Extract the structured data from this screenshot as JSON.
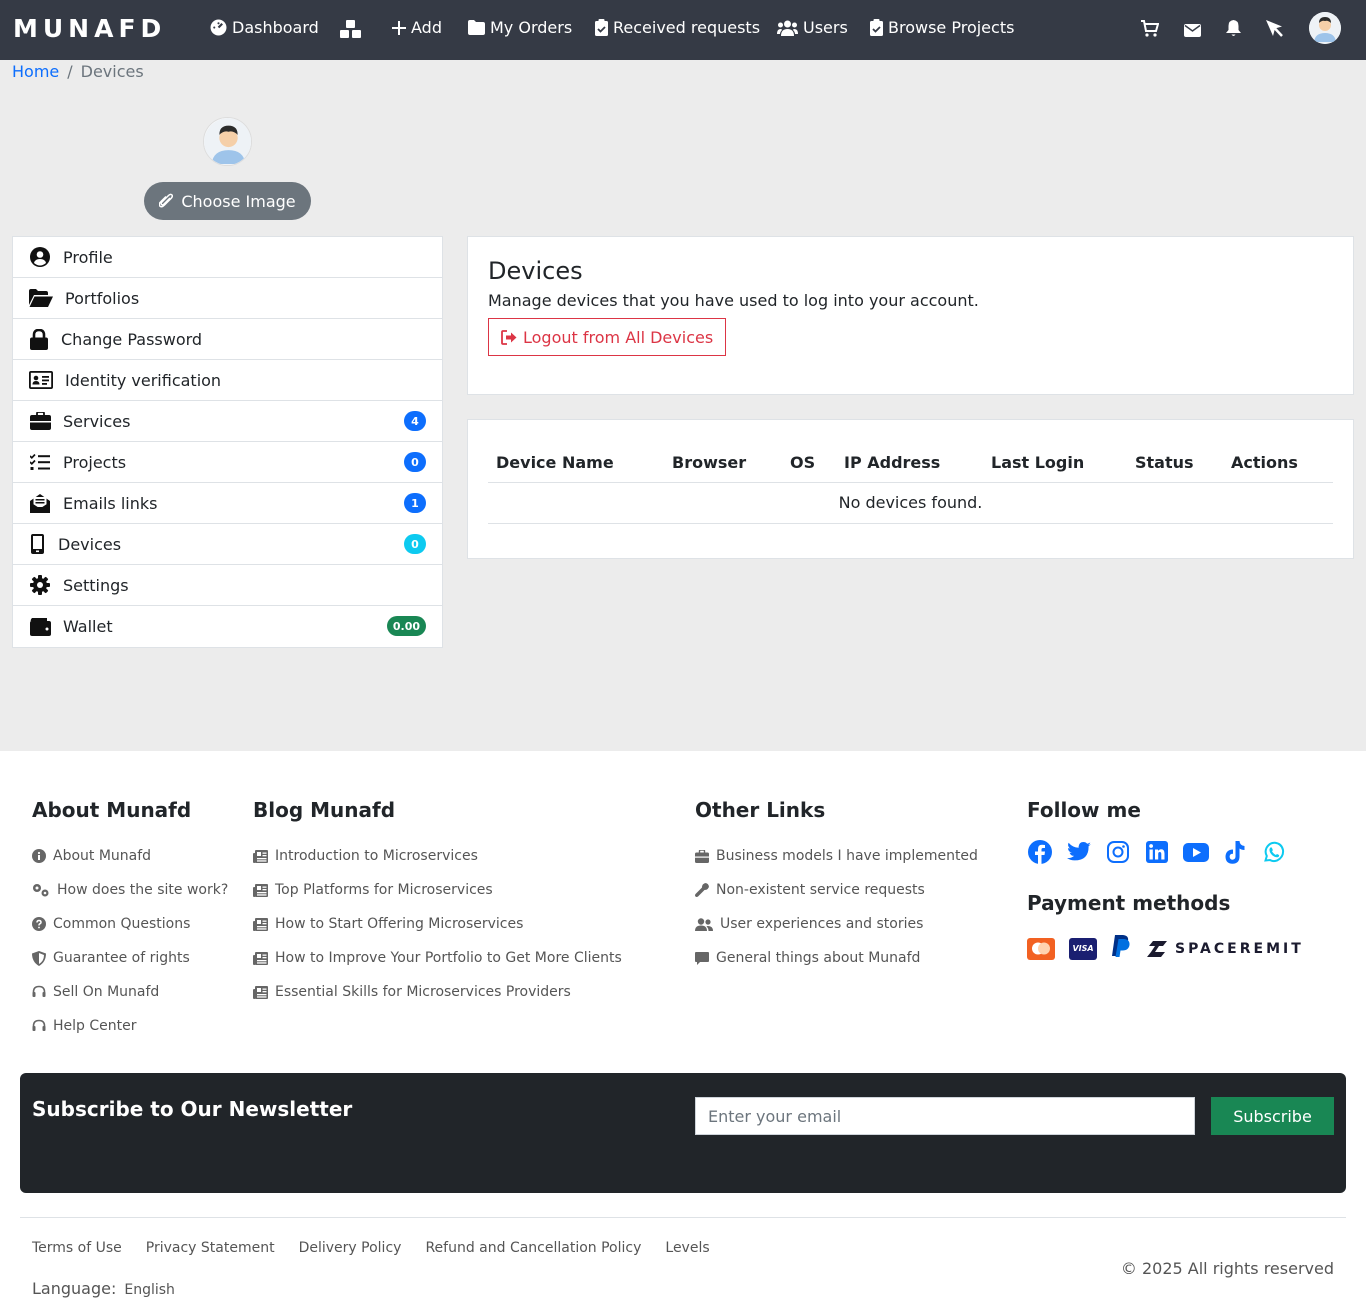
{
  "navbar": {
    "brand": "MUNAFD",
    "items": [
      {
        "label": "Dashboard"
      },
      {
        "label": "Add"
      },
      {
        "label": "My Orders"
      },
      {
        "label": "Received requests"
      },
      {
        "label": "Users"
      },
      {
        "label": "Browse Projects"
      }
    ]
  },
  "breadcrumb": {
    "home": "Home",
    "sep": "/",
    "current": "Devices"
  },
  "profile": {
    "choose_image": "Choose Image"
  },
  "sidebar": {
    "items": [
      {
        "label": "Profile",
        "icon": "user-circle-icon"
      },
      {
        "label": "Portfolios",
        "icon": "folder-open-icon"
      },
      {
        "label": "Change Password",
        "icon": "lock-icon"
      },
      {
        "label": "Identity verification",
        "icon": "id-card-icon"
      },
      {
        "label": "Services",
        "icon": "briefcase-icon",
        "badge": "4"
      },
      {
        "label": "Projects",
        "icon": "list-check-icon",
        "badge": "0"
      },
      {
        "label": "Emails links",
        "icon": "envelope-open-icon",
        "badge": "1"
      },
      {
        "label": "Devices",
        "icon": "mobile-icon",
        "badge": "0"
      },
      {
        "label": "Settings",
        "icon": "gear-icon"
      },
      {
        "label": "Wallet",
        "icon": "wallet-icon",
        "badge": "0.00"
      }
    ]
  },
  "devices": {
    "title": "Devices",
    "description": "Manage devices that you have used to log into your account.",
    "logout_all": "Logout from All Devices",
    "columns": [
      "Device Name",
      "Browser",
      "OS",
      "IP Address",
      "Last Login",
      "Status",
      "Actions"
    ],
    "empty": "No devices found."
  },
  "footer": {
    "about": {
      "title": "About Munafd",
      "links": [
        "About Munafd",
        "How does the site work?",
        "Common Questions",
        "Guarantee of rights",
        "Sell On Munafd",
        "Help Center"
      ]
    },
    "blog": {
      "title": "Blog Munafd",
      "links": [
        "Introduction to Microservices",
        "Top Platforms for Microservices",
        "How to Start Offering Microservices",
        "How to Improve Your Portfolio to Get More Clients",
        "Essential Skills for Microservices Providers"
      ]
    },
    "other": {
      "title": "Other Links",
      "links": [
        "Business models I have implemented",
        "Non-existent service requests",
        "User experiences and stories",
        "General things about Munafd"
      ]
    },
    "follow": {
      "title": "Follow me"
    },
    "payments": {
      "title": "Payment methods",
      "visa": "VISA",
      "spaceremit": "SPACEREMIT"
    },
    "newsletter": {
      "title": "Subscribe to Our Newsletter",
      "placeholder": "Enter your email",
      "button": "Subscribe"
    },
    "bottom_links": [
      "Terms of Use",
      "Privacy Statement",
      "Delivery Policy",
      "Refund and Cancellation Policy",
      "Levels"
    ],
    "language_label": "Language:",
    "language_value": "English",
    "copyright": "© 2025 All rights reserved"
  }
}
